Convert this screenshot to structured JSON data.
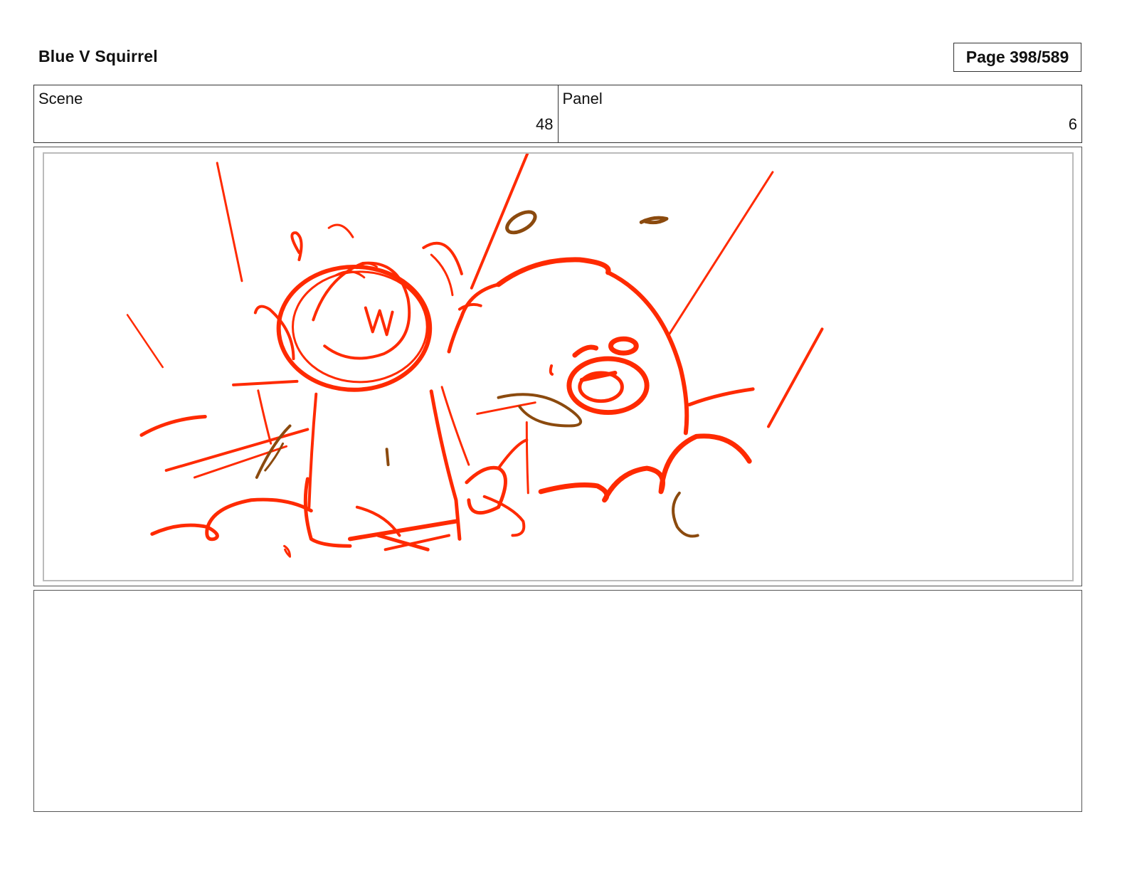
{
  "header": {
    "project_title": "Blue V Squirrel",
    "page_label": "Page 398/589"
  },
  "info": {
    "scene_label": "Scene",
    "scene_value": "48",
    "panel_label": "Panel",
    "panel_value": "6"
  },
  "sketch": {
    "stroke_primary": "#ff2a00",
    "stroke_secondary": "#8b4a0e"
  },
  "notes": {
    "text": ""
  }
}
